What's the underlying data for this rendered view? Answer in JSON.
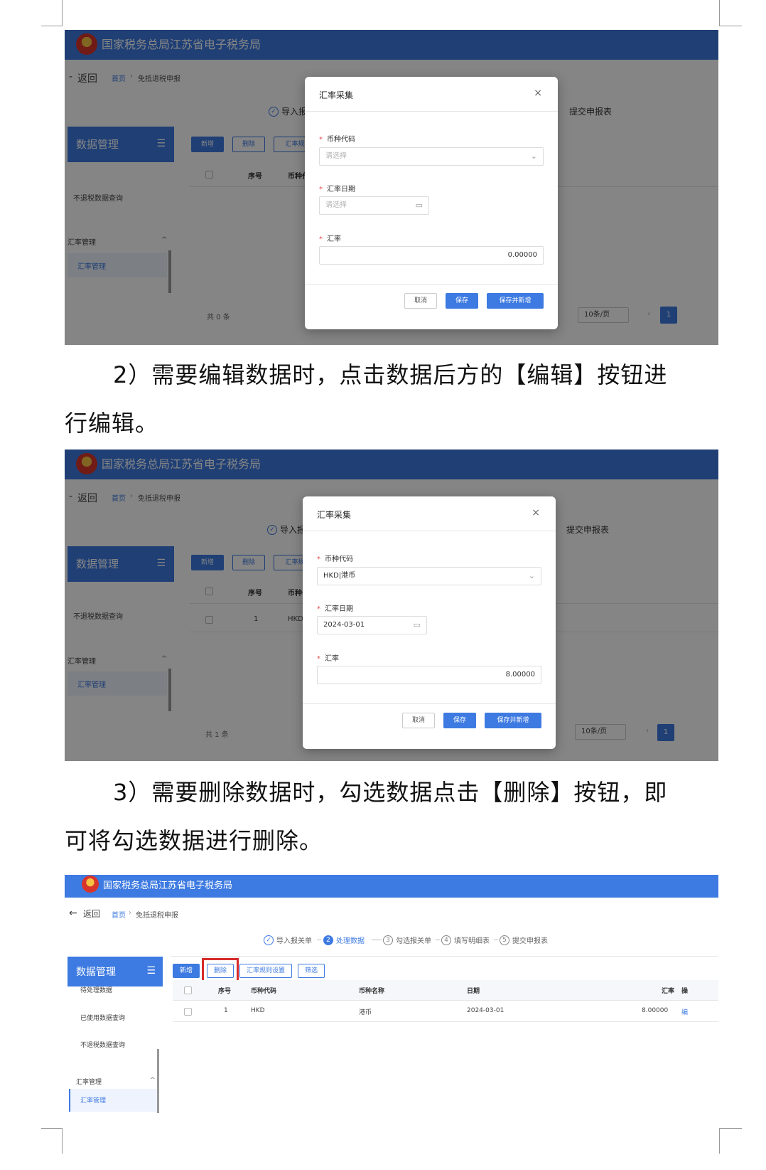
{
  "site_title": "国家税务总局江苏省电子税务局",
  "breadcrumb": {
    "back": "返回",
    "home": "首页",
    "separator": "›",
    "current": "免抵退税申报"
  },
  "steps": [
    {
      "num": "1",
      "label": "导入报关单"
    },
    {
      "num": "2",
      "label": "处理数据"
    },
    {
      "num": "3",
      "label": "勾选报关单"
    },
    {
      "num": "4",
      "label": "填写明细表"
    },
    {
      "num": "5",
      "label": "提交申报表"
    }
  ],
  "steps_partial": {
    "left": "导入报关",
    "right": "提交申报表"
  },
  "sidebar": {
    "title": "数据管理",
    "menu_icon": "☰",
    "items": [
      "待处理数据",
      "已使用数据查询",
      "不退税数据查询"
    ],
    "group": "汇率管理",
    "active_item": "汇率管理",
    "caret": "^"
  },
  "toolbar": {
    "add": "新增",
    "delete": "删除",
    "rate_rule": "汇率规则设置",
    "rate_rule_short": "汇率规",
    "filter": "筛选"
  },
  "table": {
    "headers": {
      "seq": "序号",
      "code": "币种代码",
      "code_short": "币种代",
      "name": "币种名称",
      "date": "日期",
      "rate": "汇率",
      "op": "操"
    },
    "row": {
      "seq": "1",
      "code": "HKD",
      "name": "港币",
      "date": "2024-03-01",
      "rate": "8.00000",
      "op": "编"
    }
  },
  "pager": {
    "total_0": "共 0 条",
    "total_1": "共 1 条",
    "size": "10条/页",
    "prev": "‹",
    "page": "1"
  },
  "modal": {
    "title": "汇率采集",
    "close": "×",
    "currency_label": "币种代码",
    "date_label": "汇率日期",
    "rate_label": "汇率",
    "placeholder": "请选择",
    "required_mark": "*",
    "empty_rate": "0.00000",
    "filled_currency": "HKD|港币",
    "filled_date": "2024-03-01",
    "filled_rate": "8.00000",
    "cancel": "取消",
    "save": "保存",
    "save_new": "保存并新增",
    "select_arrow": "⌄",
    "calendar_icon": "▭"
  },
  "paragraph_2": {
    "line1": "2）需要编辑数据时，点击数据后方的【编辑】按钮进",
    "line2": "行编辑。"
  },
  "paragraph_3": {
    "line1": "3）需要删除数据时，勾选数据点击【删除】按钮，即",
    "line2": "可将勾选数据进行删除。"
  }
}
